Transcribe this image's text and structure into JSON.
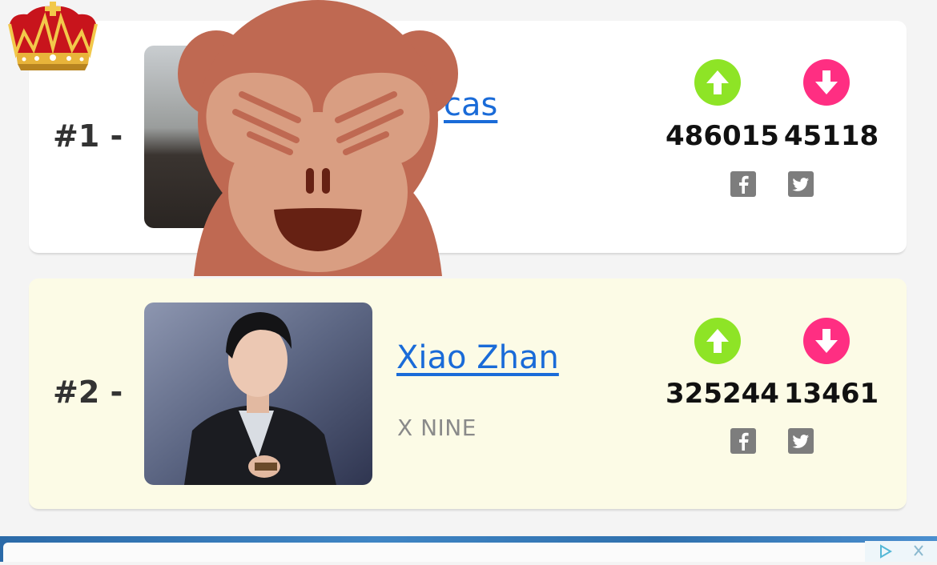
{
  "rankings": [
    {
      "rank": "#1 -",
      "name_visible": "cas",
      "up_votes": "486015",
      "down_votes": "45118",
      "highlight": false
    },
    {
      "rank": "#2 -",
      "name": "Xiao Zhan",
      "group": "X NINE",
      "up_votes": "325244",
      "down_votes": "13461",
      "highlight": true
    }
  ],
  "icons": {
    "upvote": "arrow-up-circle-icon",
    "downvote": "arrow-down-circle-icon",
    "facebook": "facebook-icon",
    "twitter": "twitter-icon",
    "crown": "crown-icon",
    "monkey": "see-no-evil-monkey-emoji"
  },
  "colors": {
    "upvote": "#8ee426",
    "downvote": "#ff2e82",
    "link": "#1a6bd8",
    "highlight_card": "#fcfbe6"
  }
}
